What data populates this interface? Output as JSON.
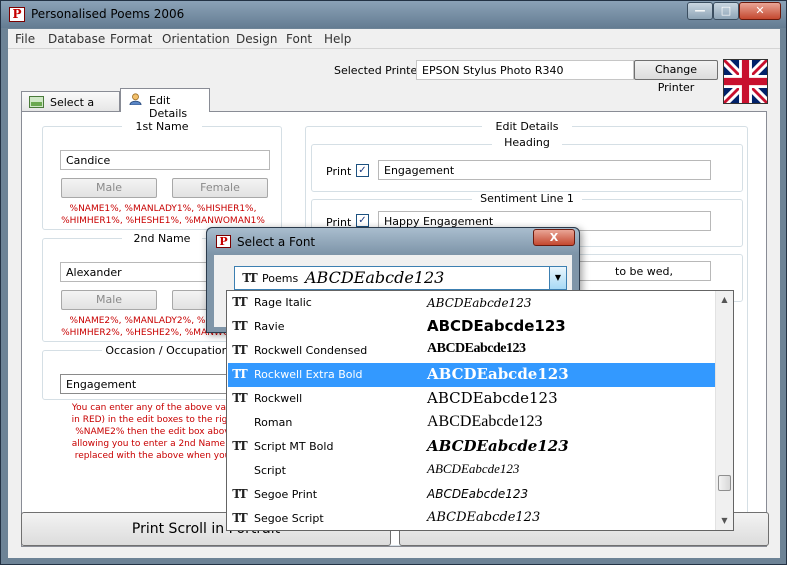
{
  "window": {
    "title": "Personalised Poems 2006"
  },
  "menu": [
    "File",
    "Database",
    "Format",
    "Orientation",
    "Design",
    "Font",
    "Help"
  ],
  "printer": {
    "label": "Selected Printer",
    "value": "EPSON Stylus Photo R340",
    "change_button": "Change Printer"
  },
  "tabs": [
    {
      "label": "Select a Style",
      "active": false
    },
    {
      "label": "Edit Details",
      "active": true
    }
  ],
  "first_name": {
    "title": "1st Name",
    "value": "Candice",
    "male_button": "Male",
    "female_button": "Female",
    "variables": "%NAME1%, %MANLADY1%, %HISHER1%,\n%HIMHER1%, %HESHE1%, %MANWOMAN1%"
  },
  "second_name": {
    "title": "2nd Name",
    "value": "Alexander",
    "male_button": "Male",
    "female_button": "Fe",
    "variables": "%NAME2%, %MANLADY2%, %HISHER2%,\n%HIMHER2%, %HESHE2%, %MANWOMAN2%"
  },
  "occasion": {
    "title": "Occasion / Occupation",
    "value": "Engagement"
  },
  "help_text": "You can enter any of the above variables\nin RED) in the edit boxes to the right, eg.\n%NAME2% then the edit box above will\nallowing you to enter a 2nd Name (All va\nreplaced with the above when you prev",
  "edit_details": {
    "title": "Edit Details",
    "heading": {
      "title": "Heading",
      "print_label": "Print",
      "checked": true,
      "value": "Engagement"
    },
    "sentiment1": {
      "title": "Sentiment Line 1",
      "print_label": "Print",
      "checked": true,
      "value": "Happy Engagement"
    },
    "line2_value": "to be wed,"
  },
  "bottom": {
    "print_button": "Print Scroll in Portrait"
  },
  "font_dialog": {
    "title": "Select a Font",
    "close": "X",
    "selected_font": "Poems",
    "selected_sample": "ABCDEabcde123"
  },
  "font_list": [
    {
      "name": "Rage Italic",
      "sample": "ABCDEabcde123",
      "truetype": true,
      "selected": false
    },
    {
      "name": "Ravie",
      "sample": "ABCDEabcde123",
      "truetype": true,
      "selected": false
    },
    {
      "name": "Rockwell Condensed",
      "sample": "ABCDEabcde123",
      "truetype": true,
      "selected": false
    },
    {
      "name": "Rockwell Extra Bold",
      "sample": "ABCDEabcde123",
      "truetype": true,
      "selected": true
    },
    {
      "name": "Rockwell",
      "sample": "ABCDEabcde123",
      "truetype": true,
      "selected": false
    },
    {
      "name": "Roman",
      "sample": "ABCDEabcde123",
      "truetype": false,
      "selected": false
    },
    {
      "name": "Script MT Bold",
      "sample": "ABCDEabcde123",
      "truetype": true,
      "selected": false
    },
    {
      "name": "Script",
      "sample": "ABCDEabcde123",
      "truetype": false,
      "selected": false
    },
    {
      "name": "Segoe Print",
      "sample": "ABCDEabcde123",
      "truetype": true,
      "selected": false
    },
    {
      "name": "Segoe Script",
      "sample": "ABCDEabcde123",
      "truetype": true,
      "selected": false
    }
  ],
  "colors": {
    "selection": "#3399ff",
    "variable_text": "#c80000"
  },
  "icons": [
    "app-p-icon",
    "minimize-icon",
    "maximize-icon",
    "close-icon",
    "uk-flag-icon",
    "picture-icon",
    "user-icon",
    "checkbox-check-icon",
    "truetype-icon",
    "dropdown-arrow-icon",
    "scroll-up-icon",
    "scroll-down-icon"
  ]
}
